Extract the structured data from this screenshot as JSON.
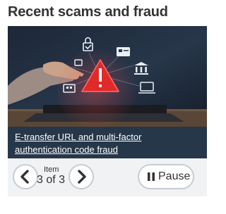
{
  "section": {
    "heading": "Recent scams and fraud"
  },
  "slide": {
    "caption": "E-transfer URL and multi-factor authentication code fraud"
  },
  "carousel": {
    "item_label": "Item",
    "position": "3 of 3",
    "pause_label": "Pause"
  },
  "icons": {
    "previous": "chevron-left-icon",
    "next": "chevron-right-icon",
    "pause": "pause-icon"
  },
  "colors": {
    "caption_background": "#26374a",
    "controls_background": "#f1f2f3",
    "warning_red": "#e02a2a"
  }
}
